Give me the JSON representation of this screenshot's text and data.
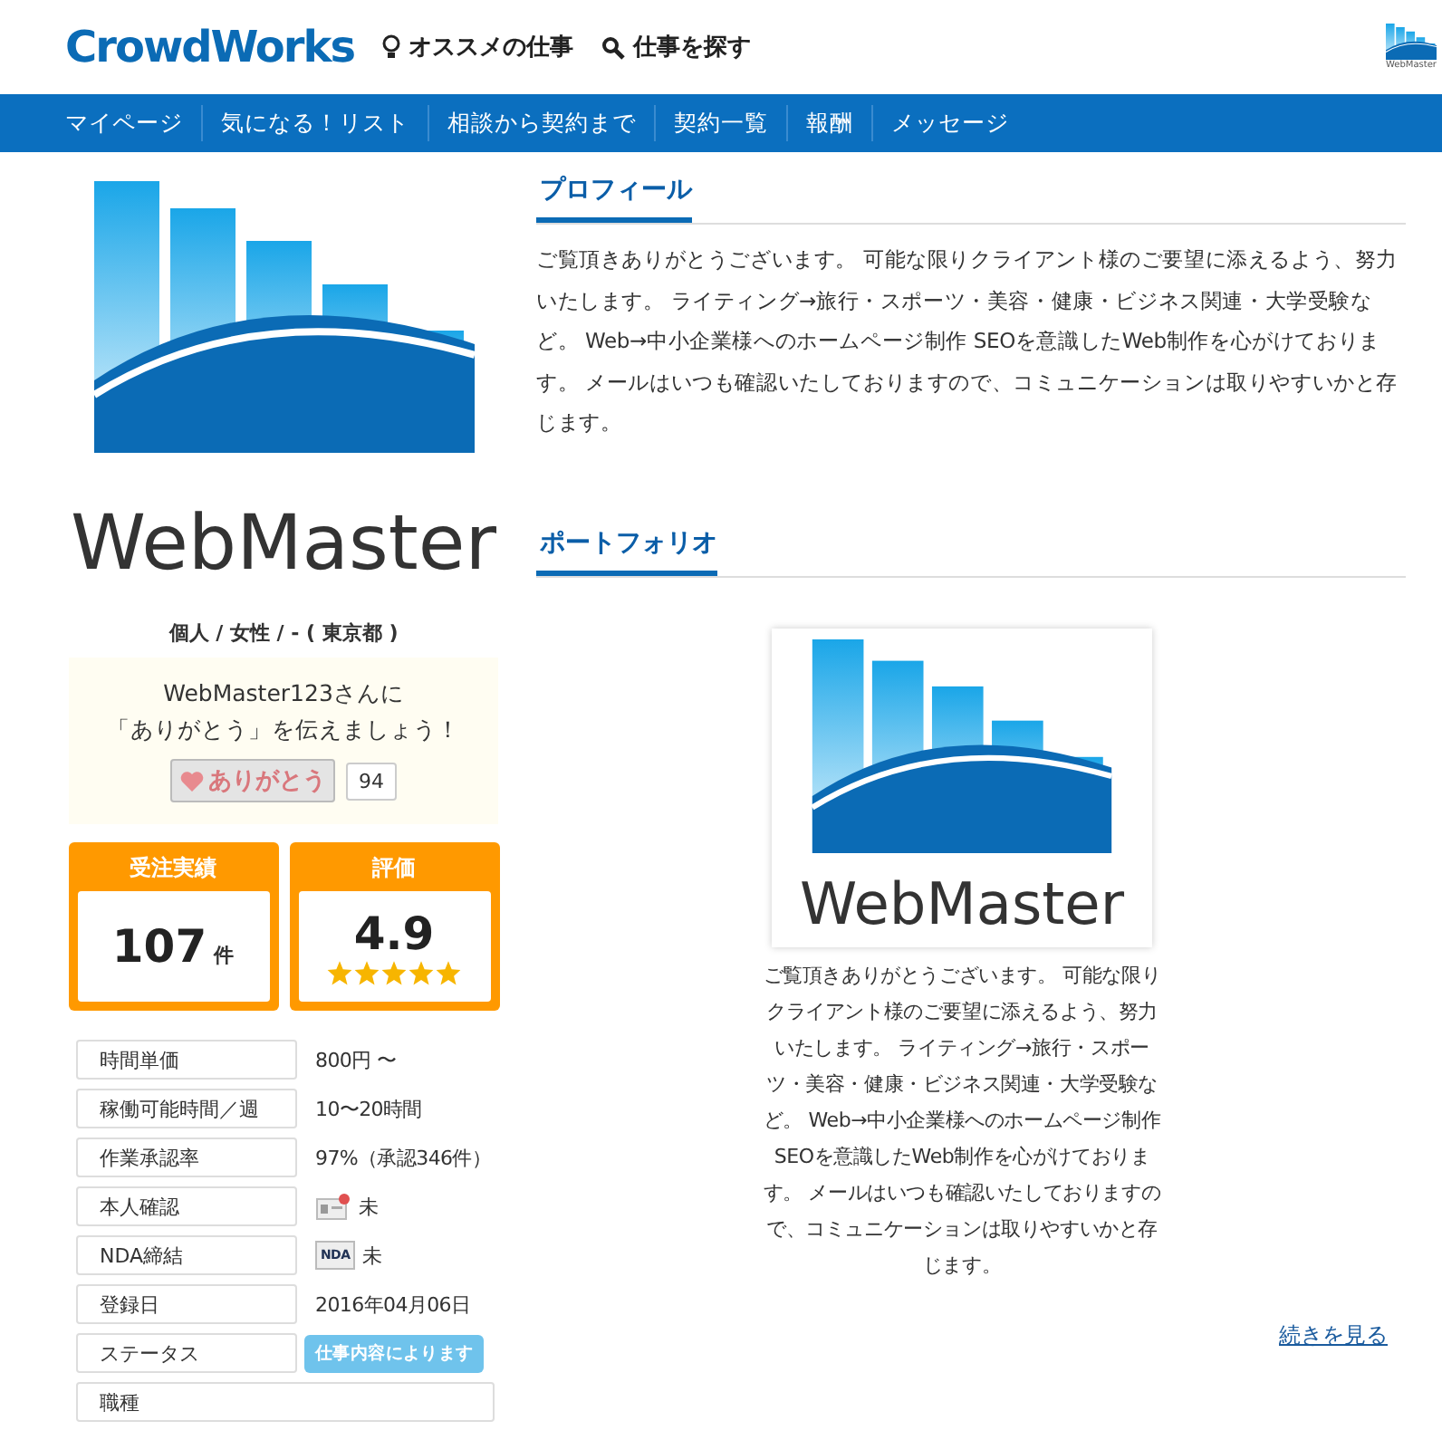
{
  "header": {
    "logo": "CrowdWorks",
    "links": [
      {
        "kind": "bulb",
        "label": "オススメの仕事"
      },
      {
        "kind": "search",
        "label": "仕事を探す"
      }
    ],
    "avatar_text": "WebMaster"
  },
  "nav": [
    "マイページ",
    "気になる！リスト",
    "相談から契約まで",
    "契約一覧",
    "報酬",
    "メッセージ"
  ],
  "profile": {
    "logo_text": "WebMaster",
    "info": "個人 / 女性 / - ( 東京都 )",
    "thanks": {
      "message": "WebMaster123さんに",
      "message2": "「ありがとう」を伝えましょう！",
      "button": "ありがとう",
      "count": "94"
    },
    "stats": [
      {
        "title": "受注実績",
        "value": "107",
        "unit": "件"
      },
      {
        "title": "評価",
        "value": "4.9",
        "stars": 5
      }
    ],
    "details": [
      {
        "kind": "text",
        "label": "時間単価",
        "value": "800円 〜"
      },
      {
        "kind": "text",
        "label": "稼働可能時間／週",
        "value": "10〜20時間"
      },
      {
        "kind": "text",
        "label": "作業承認率",
        "value": "97%（承認346件）"
      },
      {
        "kind": "id",
        "label": "本人確認",
        "value": "未"
      },
      {
        "kind": "nda",
        "label": "NDA締結",
        "icon_text": "NDA",
        "value": "未"
      },
      {
        "kind": "text",
        "label": "登録日",
        "value": "2016年04月06日"
      },
      {
        "kind": "badge",
        "label": "ステータス",
        "value": "仕事内容によります"
      },
      {
        "kind": "wide",
        "label": "職種"
      }
    ]
  },
  "sections": [
    {
      "kind": "text",
      "title": "プロフィール",
      "body": "ご覧頂きありがとうございます。 可能な限りクライアント様のご要望に添えるよう、努力いたします。 ライティング→旅行・スポーツ・美容・健康・ビジネス関連・大学受験など。 Web→中小企業様へのホームページ制作 SEOを意識したWeb制作を心がけております。 メールはいつも確認いたしておりますので、コミュニケーションは取りやすいかと存じます。"
    },
    {
      "kind": "portfolio",
      "title": "ポートフォリオ",
      "image_text": "WebMaster",
      "caption": "ご覧頂きありがとうございます。 可能な限りクライアント様のご要望に添えるよう、努力いたします。 ライティング→旅行・スポーツ・美容・健康・ビジネス関連・大学受験など。 Web→中小企業様へのホームページ制作 SEOを意識したWeb制作を心がけております。 メールはいつも確認いたしておりますので、コミュニケーションは取りやすいかと存じます。",
      "link": "続きを見る"
    }
  ]
}
